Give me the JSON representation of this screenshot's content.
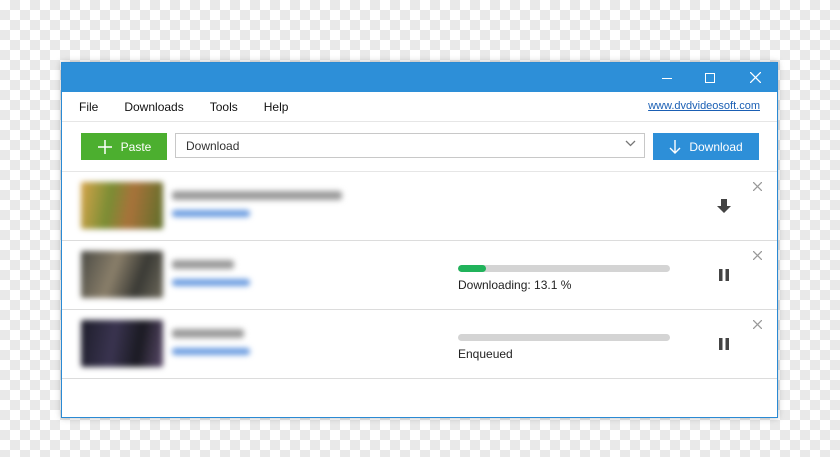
{
  "menu": {
    "items": [
      {
        "label": "File"
      },
      {
        "label": "Downloads"
      },
      {
        "label": "Tools"
      },
      {
        "label": "Help"
      }
    ],
    "site_link": "www.dvdvideosoft.com"
  },
  "toolbar": {
    "paste_label": "Paste",
    "url_value": "Download",
    "download_label": "Download"
  },
  "downloads": [
    {
      "status": "",
      "progress": null,
      "state": "done"
    },
    {
      "status": "Downloading: 13.1 %",
      "progress": 13.1,
      "state": "downloading"
    },
    {
      "status": "Enqueued",
      "progress": 0,
      "state": "queued"
    }
  ],
  "colors": {
    "titlebar": "#2d8fd8",
    "paste_button": "#4caf2f",
    "download_button": "#2d8fd8",
    "progress_fill": "#21b35b",
    "link": "#1a5fb4"
  }
}
